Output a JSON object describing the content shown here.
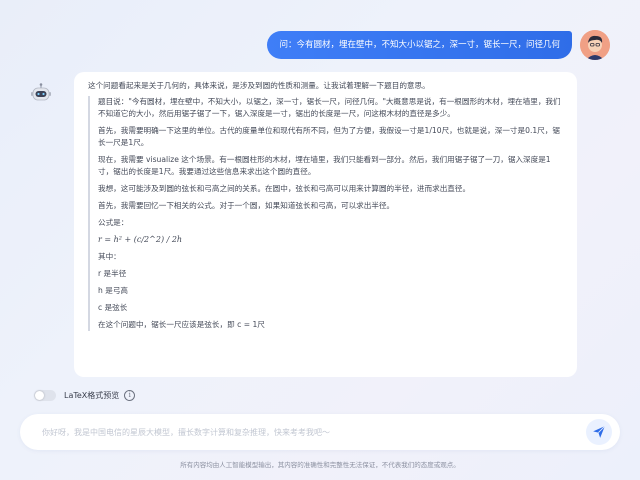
{
  "user_message": "问：今有圆材，埋在壁中，不知大小以锯之，深一寸，锯长一尺，问径几何",
  "answer": {
    "lead": "这个问题看起来是关于几何的，具体来说，是涉及到圆的性质和测量。让我试着理解一下题目的意思。",
    "paragraphs": [
      "题目说：\"今有圆材，埋在壁中，不知大小，以锯之，深一寸，锯长一尺，问径几何。\"大概意思是说，有一根圆形的木材，埋在墙里，我们不知道它的大小，然后用锯子锯了一下，锯入深度是一寸，锯出的长度是一尺，问这根木材的直径是多少。",
      "首先，我需要明确一下这里的单位。古代的度量单位和现代有所不同，但为了方便，我假设一寸是1/10尺，也就是说，深一寸是0.1尺，锯长一尺是1尺。",
      "现在，我需要 visualize 这个场景。有一根圆柱形的木材，埋在墙里，我们只能看到一部分。然后，我们用锯子锯了一刀，锯入深度是1寸，锯出的长度是1尺。我要通过这些信息来求出这个圆的直径。",
      "我想，这可能涉及到圆的弦长和弓高之间的关系。在圆中，弦长和弓高可以用来计算圆的半径，进而求出直径。",
      "首先，我需要回忆一下相关的公式。对于一个圆，如果知道弦长和弓高，可以求出半径。",
      "公式是："
    ],
    "formula": "r = h² + (c/2^2) / 2h",
    "after_formula": [
      "其中：",
      "r 是半径",
      "h 是弓高",
      "c 是弦长",
      "在这个问题中，锯长一尺应该是弦长，即 c = 1尺"
    ]
  },
  "latex_toggle": {
    "label": "LaTeX格式预览",
    "on": false,
    "info_glyph": "i"
  },
  "input": {
    "placeholder": "你好呀，我是中国电信的星辰大模型，擅长数字计算和复杂推理，快来考考我吧～",
    "value": ""
  },
  "disclaimer": "所有内容均由人工智能模型输出，其内容的准确性和完整性无法保证，不代表我们的态度或观点。",
  "colors": {
    "accent": "#2f6de8",
    "background": "#edf1fa"
  },
  "icons": {
    "send": "send-icon",
    "bot": "robot-icon",
    "user": "user-avatar-icon",
    "info": "info-icon"
  }
}
